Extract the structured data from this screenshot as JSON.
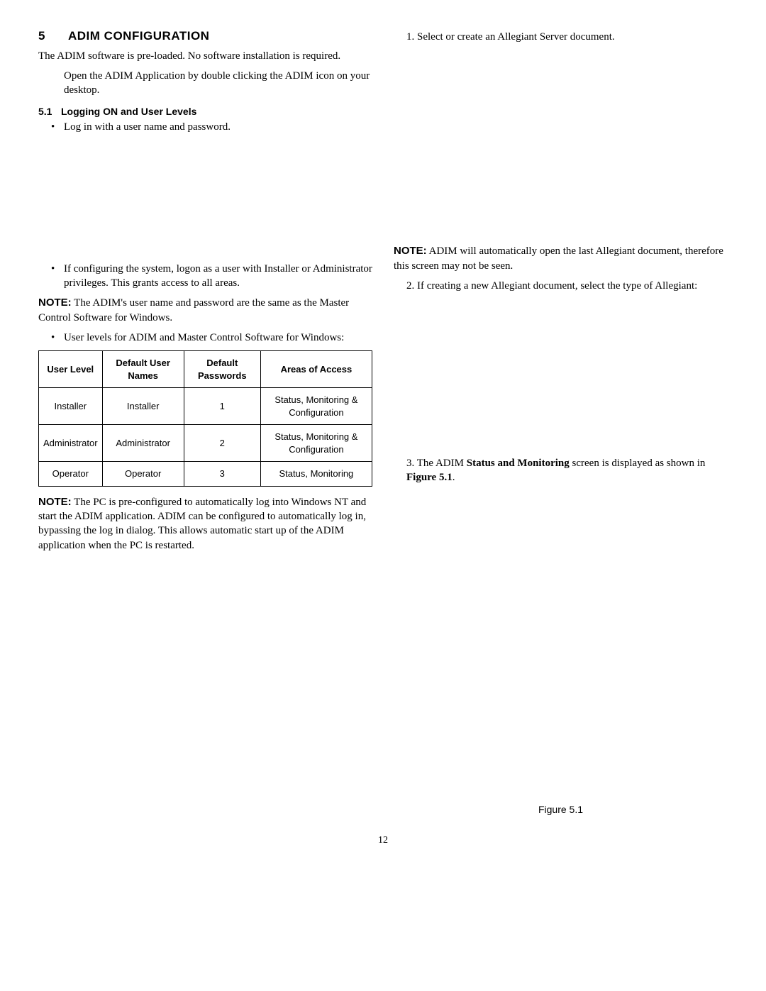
{
  "section": {
    "number": "5",
    "title": "ADIM CONFIGURATION",
    "intro": "The ADIM software is pre-loaded. No software installation is required.",
    "open_app": "Open the ADIM Application by double clicking the ADIM icon on your desktop."
  },
  "sub": {
    "number": "5.1",
    "title": "Logging ON and User Levels",
    "bullet1": "Log in with a user name and password.",
    "bullet2": "If configuring the system, logon as a user with Installer or Administrator privileges. This grants access to all areas.",
    "note1_label": "NOTE:",
    "note1_text": "The ADIM's user name and password are the same as the Master Control Software for Windows.",
    "bullet3": "User levels for ADIM and Master Control Software for Windows:",
    "note2_label": "NOTE:",
    "note2_text": "The PC is pre-configured to automatically log into Windows NT and start the ADIM application. ADIM can be configured to automatically log in, bypassing the log in dialog. This allows automatic start up of the ADIM application when the PC is restarted."
  },
  "table": {
    "headers": {
      "c1": "User Level",
      "c2": "Default User Names",
      "c3": "Default Passwords",
      "c4": "Areas of Access"
    },
    "rows": [
      {
        "c1": "Installer",
        "c2": "Installer",
        "c3": "1",
        "c4": "Status, Monitoring & Configuration"
      },
      {
        "c1": "Administrator",
        "c2": "Administrator",
        "c3": "2",
        "c4": "Status, Monitoring & Configuration"
      },
      {
        "c1": "Operator",
        "c2": "Operator",
        "c3": "3",
        "c4": "Status, Monitoring"
      }
    ]
  },
  "right": {
    "step1": "1. Select or create an Allegiant Server document.",
    "note_label": "NOTE:",
    "note_text": "ADIM will automatically open the last Allegiant document, therefore this screen may not be seen.",
    "step2": "2. If creating a new Allegiant document, select the type of Allegiant:",
    "step3_pre": "3. The ADIM ",
    "step3_bold": "Status and Monitoring",
    "step3_mid": " screen is displayed as shown in ",
    "step3_figref": "Figure 5.1",
    "step3_post": "."
  },
  "figure_caption": "Figure 5.1",
  "page_number": "12"
}
